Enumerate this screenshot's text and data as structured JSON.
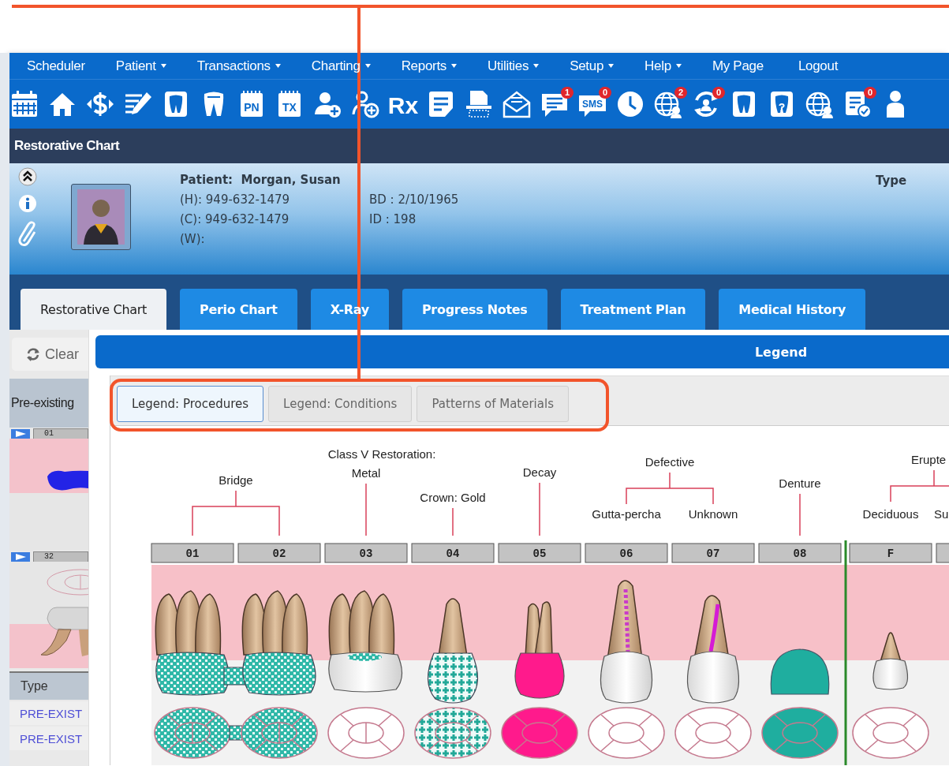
{
  "menu": [
    {
      "label": "Scheduler",
      "dropdown": false
    },
    {
      "label": "Patient",
      "dropdown": true
    },
    {
      "label": "Transactions",
      "dropdown": true
    },
    {
      "label": "Charting",
      "dropdown": true
    },
    {
      "label": "Reports",
      "dropdown": true
    },
    {
      "label": "Utilities",
      "dropdown": true
    },
    {
      "label": "Setup",
      "dropdown": true
    },
    {
      "label": "Help",
      "dropdown": true
    },
    {
      "label": "My Page",
      "dropdown": false
    },
    {
      "label": "Logout",
      "dropdown": false
    }
  ],
  "toolbar": [
    {
      "kind": "calendar"
    },
    {
      "kind": "home"
    },
    {
      "kind": "dollar"
    },
    {
      "kind": "edit"
    },
    {
      "kind": "tooth-card"
    },
    {
      "kind": "tooth"
    },
    {
      "kind": "tag",
      "label": "PN"
    },
    {
      "kind": "tag",
      "label": "TX"
    },
    {
      "kind": "person-plus"
    },
    {
      "kind": "person-plus-outline"
    },
    {
      "kind": "rx",
      "label": "Rx"
    },
    {
      "kind": "note"
    },
    {
      "kind": "scan"
    },
    {
      "kind": "mail"
    },
    {
      "kind": "chat",
      "badge": "1"
    },
    {
      "kind": "sms",
      "label": "SMS",
      "badge": "0"
    },
    {
      "kind": "clock"
    },
    {
      "kind": "globe",
      "badge": "2"
    },
    {
      "kind": "sync",
      "badge": "0"
    },
    {
      "kind": "tooth-card"
    },
    {
      "kind": "tooth-card",
      "label": "?"
    },
    {
      "kind": "globe"
    },
    {
      "kind": "document",
      "badge": "0"
    },
    {
      "kind": "person"
    }
  ],
  "page_title": "Restorative Chart",
  "patient": {
    "label": "Patient:",
    "name": "Morgan, Susan",
    "home": "(H): 949-632-1479",
    "cell": "(C):  949-632-1479",
    "work": "(W):",
    "birthdate": "BD : 2/10/1965",
    "id": "ID : 198",
    "type_label": "Type"
  },
  "tabs": [
    {
      "label": "Restorative Chart",
      "selected": true
    },
    {
      "label": "Perio Chart",
      "selected": false
    },
    {
      "label": "X-Ray",
      "selected": false
    },
    {
      "label": "Progress Notes",
      "selected": false
    },
    {
      "label": "Treatment Plan",
      "selected": false
    },
    {
      "label": "Medical History",
      "selected": false
    }
  ],
  "side_panel": {
    "clear_button": "Clear",
    "section_title": "Pre-existing",
    "teeth": [
      {
        "number": "01",
        "kind": "upper"
      },
      {
        "number": "32",
        "kind": "lower"
      }
    ],
    "table": {
      "columns": [
        "Type"
      ],
      "rows": [
        [
          "PRE-EXIST"
        ],
        [
          "PRE-EXIST"
        ]
      ]
    }
  },
  "dialog": {
    "title": "Legend",
    "tabs": [
      {
        "label": "Legend: Procedures",
        "selected": true
      },
      {
        "label": "Legend: Conditions",
        "selected": false
      },
      {
        "label": "Patterns of Materials",
        "selected": false
      }
    ],
    "groups": [
      {
        "kind": "bracket",
        "label": [
          "Bridge"
        ],
        "teeth": [
          {
            "number": "01",
            "kind": "bridge"
          },
          {
            "number": "02",
            "kind": "bridge"
          }
        ]
      },
      {
        "kind": "single",
        "label": [
          "Class V Restoration:",
          "Metal"
        ],
        "teeth": [
          {
            "number": "03",
            "kind": "class5"
          }
        ]
      },
      {
        "kind": "single",
        "label": [
          "Crown: Gold"
        ],
        "teeth": [
          {
            "number": "04",
            "kind": "crown-gold"
          }
        ]
      },
      {
        "kind": "single",
        "label": [
          "Decay"
        ],
        "teeth": [
          {
            "number": "05",
            "kind": "decay"
          }
        ]
      },
      {
        "kind": "branch",
        "label": [
          "Defective"
        ],
        "teeth": [
          {
            "number": "06",
            "kind": "gutta-percha",
            "sub_label": "Gutta-percha"
          },
          {
            "number": "07",
            "kind": "unknown",
            "sub_label": "Unknown"
          }
        ]
      },
      {
        "kind": "single",
        "label": [
          "Denture"
        ],
        "teeth": [
          {
            "number": "08",
            "kind": "denture"
          }
        ]
      },
      {
        "kind": "branch",
        "separated": true,
        "label": [
          "Erupte"
        ],
        "teeth": [
          {
            "number": "F",
            "kind": "deciduous",
            "sub_label": "Deciduous"
          },
          {
            "kind": "cut",
            "sub_label": "Su"
          }
        ]
      }
    ]
  }
}
